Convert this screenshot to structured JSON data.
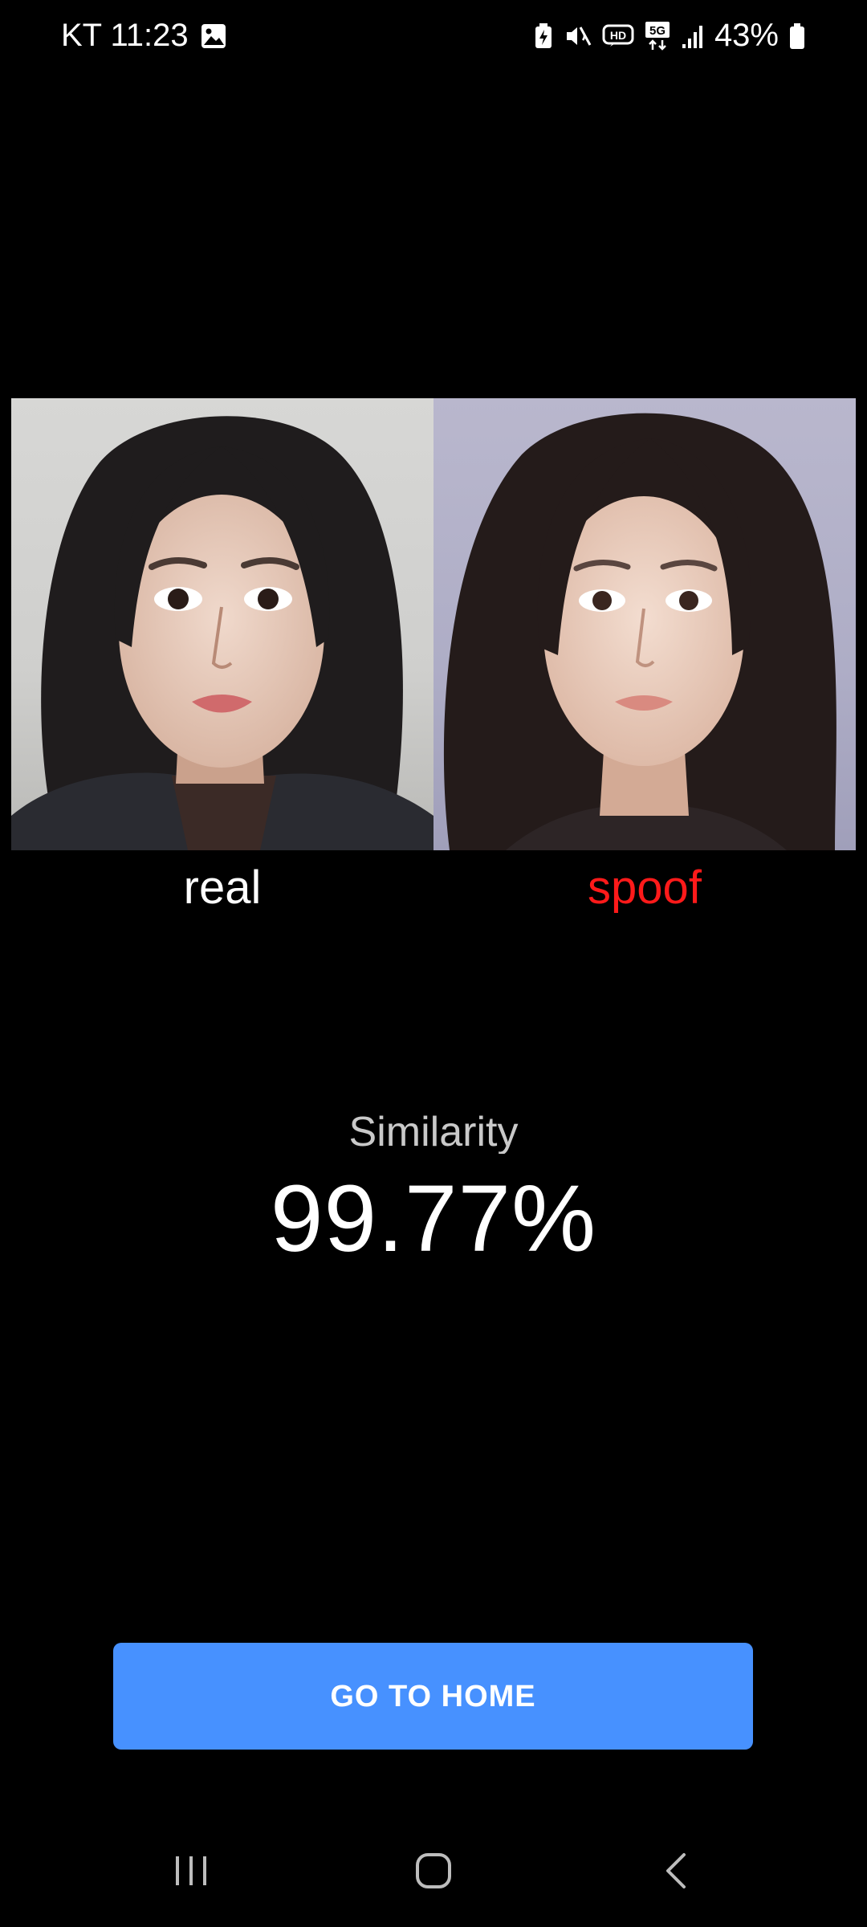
{
  "status_bar": {
    "carrier_time": "KT 11:23",
    "network": "5G",
    "battery": "43%"
  },
  "comparison": {
    "left_label": "real",
    "right_label": "spoof",
    "colors": {
      "left_label": "#ffffff",
      "right_label": "#ff1a1a"
    }
  },
  "result": {
    "title": "Similarity",
    "value": "99.77%"
  },
  "actions": {
    "home_button_label": "GO TO HOME",
    "button_color": "#4791ff"
  },
  "nav_bar": {
    "icons": [
      "recents-icon",
      "home-icon",
      "back-icon"
    ]
  }
}
